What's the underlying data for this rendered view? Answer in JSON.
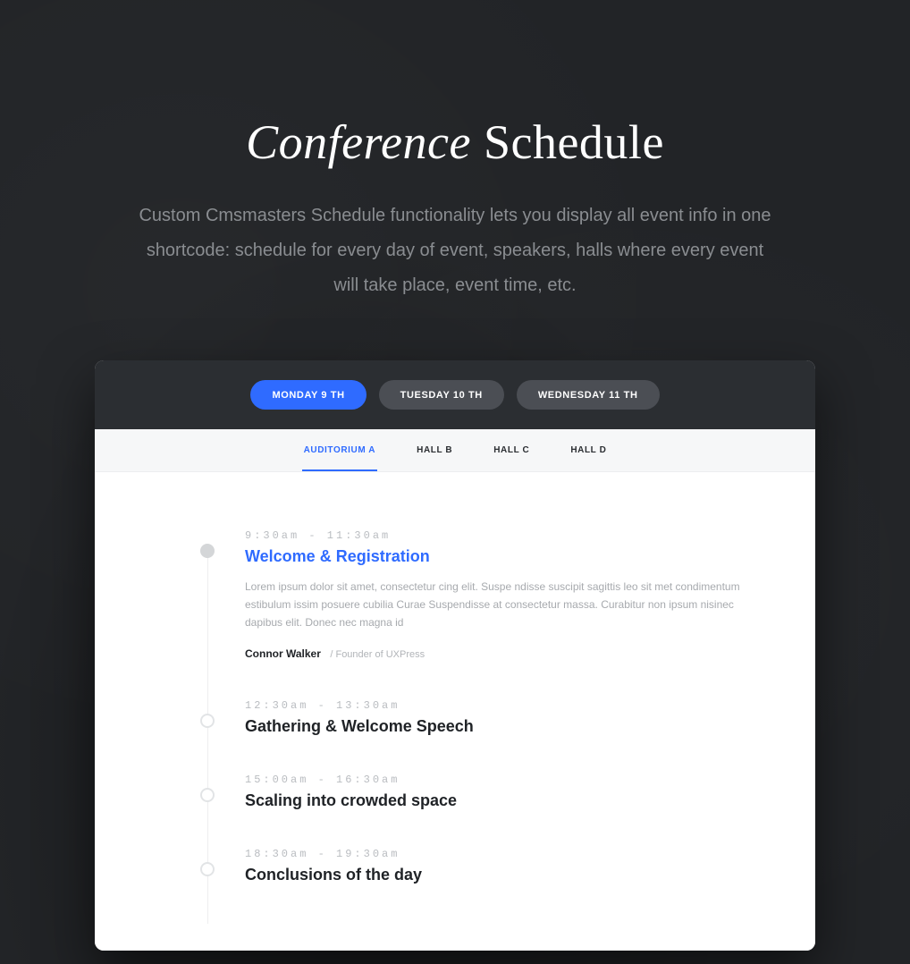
{
  "heading": {
    "italic": "Conference",
    "rest": " Schedule"
  },
  "description": "Custom Cmsmasters Schedule functionality lets you display all event info in one shortcode: schedule for every day of event, speakers, halls where every event will take place, event time, etc.",
  "days": [
    {
      "label": "MONDAY 9 TH",
      "active": true
    },
    {
      "label": "TUESDAY 10 TH",
      "active": false
    },
    {
      "label": "WEDNESDAY 11 TH",
      "active": false
    }
  ],
  "halls": [
    {
      "label": "AUDITORIUM A",
      "active": true
    },
    {
      "label": "HALL B",
      "active": false
    },
    {
      "label": "HALL C",
      "active": false
    },
    {
      "label": "HALL D",
      "active": false
    }
  ],
  "sessions": [
    {
      "time": "9:30am - 11:30am",
      "title": "Welcome & Registration",
      "highlight": true,
      "filledDot": true,
      "desc": "Lorem ipsum dolor sit amet, consectetur cing elit. Suspe ndisse suscipit sagittis leo sit met condimentum estibulum issim posuere cubilia Curae Suspendisse at consectetur massa. Curabitur non ipsum nisinec dapibus elit. Donec nec magna id",
      "speaker": "Connor Walker",
      "role": "/ Founder of UXPress"
    },
    {
      "time": "12:30am - 13:30am",
      "title": "Gathering & Welcome Speech",
      "highlight": false,
      "filledDot": false
    },
    {
      "time": "15:00am - 16:30am",
      "title": "Scaling into crowded space",
      "highlight": false,
      "filledDot": false
    },
    {
      "time": "18:30am - 19:30am",
      "title": "Conclusions of the day",
      "highlight": false,
      "filledDot": false
    }
  ]
}
